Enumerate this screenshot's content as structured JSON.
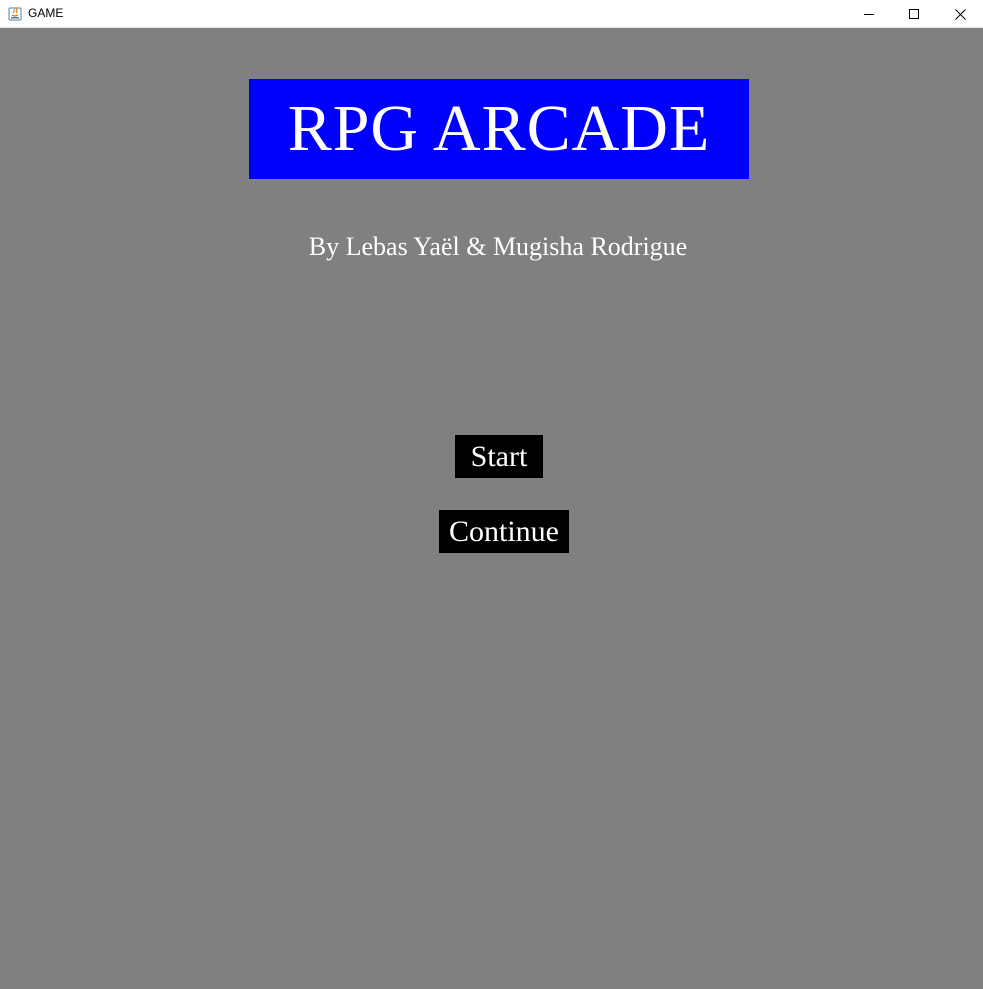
{
  "window": {
    "title": "GAME",
    "app_icon": "java-icon",
    "controls": [
      "minimize-icon",
      "maximize-icon",
      "close-icon"
    ]
  },
  "game": {
    "title": "RPG ARCADE",
    "credits": "By Lebas Yaël & Mugisha Rodrigue",
    "menu": {
      "start_label": "Start",
      "continue_label": "Continue"
    }
  },
  "colors": {
    "background": "#808080",
    "title_box": "#0000ff",
    "button_bg": "#000000",
    "text": "#ffffff"
  }
}
